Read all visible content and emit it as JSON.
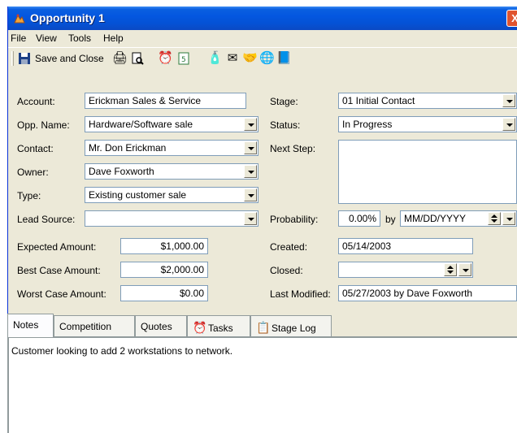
{
  "window": {
    "title": "Opportunity 1",
    "close_glyph": "X"
  },
  "menu": {
    "file": "File",
    "view": "View",
    "tools": "Tools",
    "help": "Help"
  },
  "toolbar": {
    "save_close": "Save and Close"
  },
  "labels": {
    "account": "Account:",
    "opp_name": "Opp. Name:",
    "contact": "Contact:",
    "owner": "Owner:",
    "type": "Type:",
    "lead_source": "Lead Source:",
    "expected_amount": "Expected Amount:",
    "best_case_amount": "Best Case Amount:",
    "worst_case_amount": "Worst Case Amount:",
    "stage": "Stage:",
    "status": "Status:",
    "next_step": "Next Step:",
    "probability": "Probability:",
    "by": "by",
    "created": "Created:",
    "closed": "Closed:",
    "last_modified": "Last Modified:"
  },
  "fields": {
    "account": "Erickman Sales & Service",
    "opp_name": "Hardware/Software sale",
    "contact": "Mr. Don Erickman",
    "owner": "Dave Foxworth",
    "type": "Existing customer sale",
    "lead_source": "",
    "expected_amount": "$1,000.00",
    "best_case_amount": "$2,000.00",
    "worst_case_amount": "$0.00",
    "stage": "01 Initial Contact",
    "status": "In Progress",
    "next_step": "",
    "probability": "0.00%",
    "probability_date": "MM/DD/YYYY",
    "created": "05/14/2003",
    "closed": "",
    "last_modified": "05/27/2003 by Dave Foxworth"
  },
  "tabs": [
    "Notes",
    "Competition",
    "Quotes",
    "Tasks",
    "Stage Log"
  ],
  "notes_text": "Customer looking to add 2 workstations to network.",
  "colors": {
    "titlebar": "#0457e0",
    "window_bg": "#ece9d8",
    "field_border": "#7f9db9",
    "close_button": "#e0542f"
  }
}
